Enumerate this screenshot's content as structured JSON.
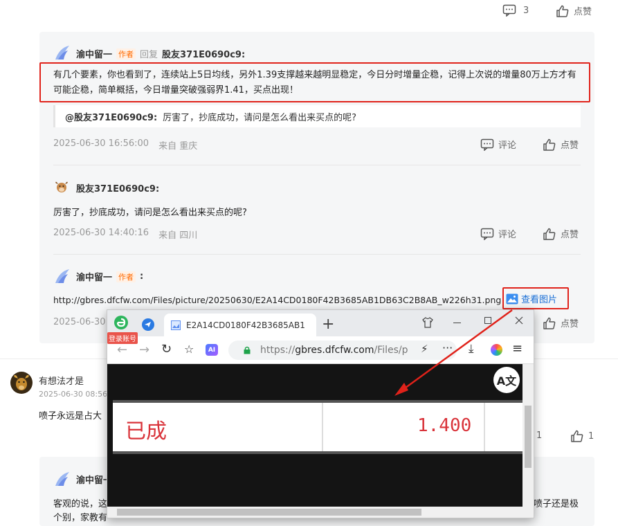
{
  "top_actions": {
    "comment_count": "3",
    "like_label": "点赞"
  },
  "reply1": {
    "author": "渝中留一",
    "author_tag": "作者",
    "reply_word": "回复",
    "reply_to": "股友371E0690c9:",
    "text": "有几个要素，你也看到了，连续站上5日均线，另外1.39支撑越来越明显稳定，今日分时增量企稳，记得上次说的增量80万上方才有可能企稳，简单概括，今日增量突破强弱界1.41，买点出现！",
    "quote_user": "@股友371E0690c9:",
    "quote_text": "厉害了，抄底成功，请问是怎么看出来买点的呢?",
    "time": "2025-06-30 16:56:00",
    "location": "来自 重庆",
    "comment_label": "评论",
    "like_label": "点赞"
  },
  "reply2": {
    "author": "股友371E0690c9:",
    "text": "厉害了，抄底成功，请问是怎么看出来买点的呢?",
    "time": "2025-06-30 14:40:16",
    "location": "来自 四川",
    "comment_label": "评论",
    "like_label": "点赞"
  },
  "reply3": {
    "author": "渝中留一",
    "author_tag": "作者",
    "colon": ":",
    "link": "http://gbres.dfcfw.com/Files/picture/20250630/E2A14CD0180F42B3685AB1DB63C2B8AB_w226h31.png",
    "view_image": "查看图片",
    "time": "2025-06-30 1",
    "like_label": "点赞"
  },
  "post2": {
    "author": "有想法才是",
    "time": "2025-06-30 08:56",
    "text": "喷子永远是占大",
    "comment_count": "1",
    "like_count": "1"
  },
  "reply4": {
    "author": "渝中留一",
    "text_l1": "客观的说，这",
    "text_r1": "喷子还是极",
    "text_l2": "个别，家教有"
  },
  "browser": {
    "login_badge": "登录账号",
    "tab_title": "E2A14CD0180F42B3685AB1",
    "url_prefix": "https://",
    "url_host": "gbres.dfcfw.com",
    "url_path": "/Files/p",
    "image_label": "已成",
    "image_value": "1.400",
    "ai_label": "AI"
  },
  "colors": {
    "highlight": "#e0221a",
    "link": "#1a6fd6",
    "author_tag": "#ff6a00"
  }
}
